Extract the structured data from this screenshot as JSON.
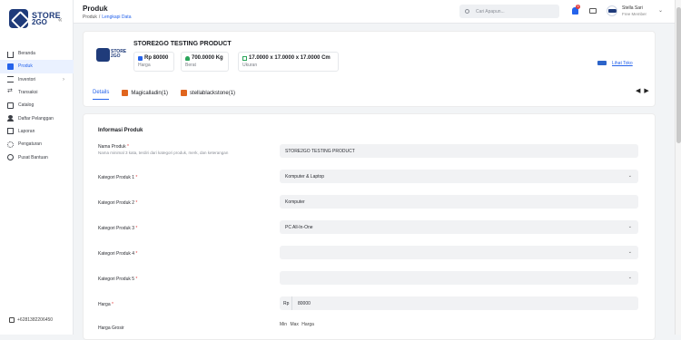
{
  "sidebar": {
    "logo_line1": "STORE",
    "logo_line2": "2GO",
    "collapse_icon": "chevrons-left-icon",
    "items": [
      {
        "label": "Beranda",
        "icon": "home-icon"
      },
      {
        "label": "Produk",
        "icon": "box-icon",
        "active": true
      },
      {
        "label": "Inventori",
        "icon": "inventory-icon",
        "has_submenu": true
      },
      {
        "label": "Transaksi",
        "icon": "transaction-icon"
      },
      {
        "label": "Catalog",
        "icon": "tag-icon"
      },
      {
        "label": "Daftar Pelanggan",
        "icon": "users-icon"
      },
      {
        "label": "Laporan",
        "icon": "report-icon"
      },
      {
        "label": "Pengaturan",
        "icon": "gear-icon"
      },
      {
        "label": "Pusat Bantuan",
        "icon": "help-icon"
      }
    ],
    "phone": "+6281382206450"
  },
  "header": {
    "title": "Produk",
    "breadcrumb": [
      "Produk",
      "Lengkapi Data"
    ],
    "search_placeholder": "Cari Apapun...",
    "notif_count": "3",
    "user_name": "Stella Sari",
    "user_role": "Free Member"
  },
  "product": {
    "name": "STORE2GO TESTING PRODUCT",
    "logo_text_1": "STORE",
    "logo_text_2": "2GO",
    "stats": [
      {
        "value": "Rp 80000",
        "label": "Harga"
      },
      {
        "value": "700.0000 Kg",
        "label": "Berat"
      },
      {
        "value": "17.0000 x 17.0000 x 17.0000 Cm",
        "label": "Ukuran"
      }
    ],
    "link_label": "Lihat Toko",
    "tabs": [
      {
        "label": "Details",
        "active": true
      },
      {
        "label": "Magicalladin(1)"
      },
      {
        "label": "stellablackstone(1)"
      }
    ]
  },
  "form": {
    "section_title": "Informasi Produk",
    "nama_label": "Nama Produk",
    "nama_hint": "Nama minimal 3 kata, terdiri dari kategori produk, merk, dan keterangan",
    "nama_value": "STORE2GO TESTING PRODUCT",
    "kategori": [
      {
        "label": "Kategori Produk 1",
        "value": "Komputer & Laptop"
      },
      {
        "label": "Kategori Produk 2",
        "value": "Komputer"
      },
      {
        "label": "Kategori Produk 3",
        "value": "PC All-In-One"
      },
      {
        "label": "Kategori Produk 4",
        "value": ""
      },
      {
        "label": "Kategori Produk 5",
        "value": ""
      }
    ],
    "harga_label": "Harga",
    "harga_prefix": "Rp",
    "harga_value": "80000",
    "grosir_label": "Harga Grosir",
    "grosir_cols": "Min  Max  Harga"
  },
  "colors": {
    "accent": "#2563eb",
    "brand": "#1f3b7a",
    "badge": "#e23b3b"
  }
}
